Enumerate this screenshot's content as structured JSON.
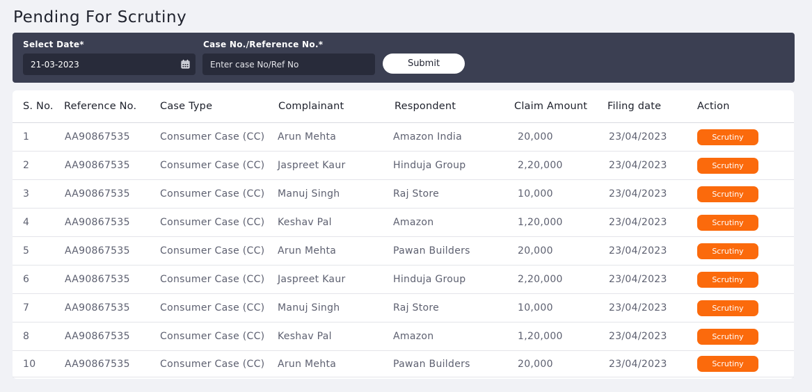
{
  "page": {
    "title": "Pending For Scrutiny"
  },
  "filters": {
    "date_label": "Select Date*",
    "date_value": "21-03-2023",
    "case_label": "Case No./Reference No.*",
    "case_placeholder": "Enter case No/Ref No",
    "submit_label": "Submit",
    "calendar_icon": "calendar-icon"
  },
  "colors": {
    "bar_bg": "#3b3f52",
    "input_bg": "#282b3a",
    "accent": "#fb6a0c"
  },
  "table": {
    "headers": [
      "S. No.",
      "Reference No.",
      "Case Type",
      "Complainant",
      "Respondent",
      "Claim Amount",
      "Filing date",
      "Action"
    ],
    "rows": [
      [
        "1",
        "AA90867535",
        "Consumer Case (CC)",
        "Arun Mehta",
        "Amazon India",
        "20,000",
        "23/04/2023",
        "Scrutiny"
      ],
      [
        "2",
        "AA90867535",
        "Consumer Case (CC)",
        "Jaspreet Kaur",
        "Hinduja Group",
        "2,20,000",
        "23/04/2023",
        "Scrutiny"
      ],
      [
        "3",
        "AA90867535",
        "Consumer Case (CC)",
        "Manuj Singh",
        "Raj Store",
        "10,000",
        "23/04/2023",
        "Scrutiny"
      ],
      [
        "4",
        "AA90867535",
        "Consumer Case (CC)",
        "Keshav Pal",
        "Amazon",
        "1,20,000",
        "23/04/2023",
        "Scrutiny"
      ],
      [
        "5",
        "AA90867535",
        "Consumer Case (CC)",
        "Arun Mehta",
        "Pawan Builders",
        "20,000",
        "23/04/2023",
        "Scrutiny"
      ],
      [
        "6",
        "AA90867535",
        "Consumer Case (CC)",
        "Jaspreet Kaur",
        "Hinduja Group",
        "2,20,000",
        "23/04/2023",
        "Scrutiny"
      ],
      [
        "7",
        "AA90867535",
        "Consumer Case (CC)",
        "Manuj Singh",
        "Raj Store",
        "10,000",
        "23/04/2023",
        "Scrutiny"
      ],
      [
        "8",
        "AA90867535",
        "Consumer Case (CC)",
        "Keshav Pal",
        "Amazon",
        "1,20,000",
        "23/04/2023",
        "Scrutiny"
      ],
      [
        "10",
        "AA90867535",
        "Consumer Case (CC)",
        "Arun Mehta",
        "Pawan Builders",
        "20,000",
        "23/04/2023",
        "Scrutiny"
      ]
    ]
  }
}
